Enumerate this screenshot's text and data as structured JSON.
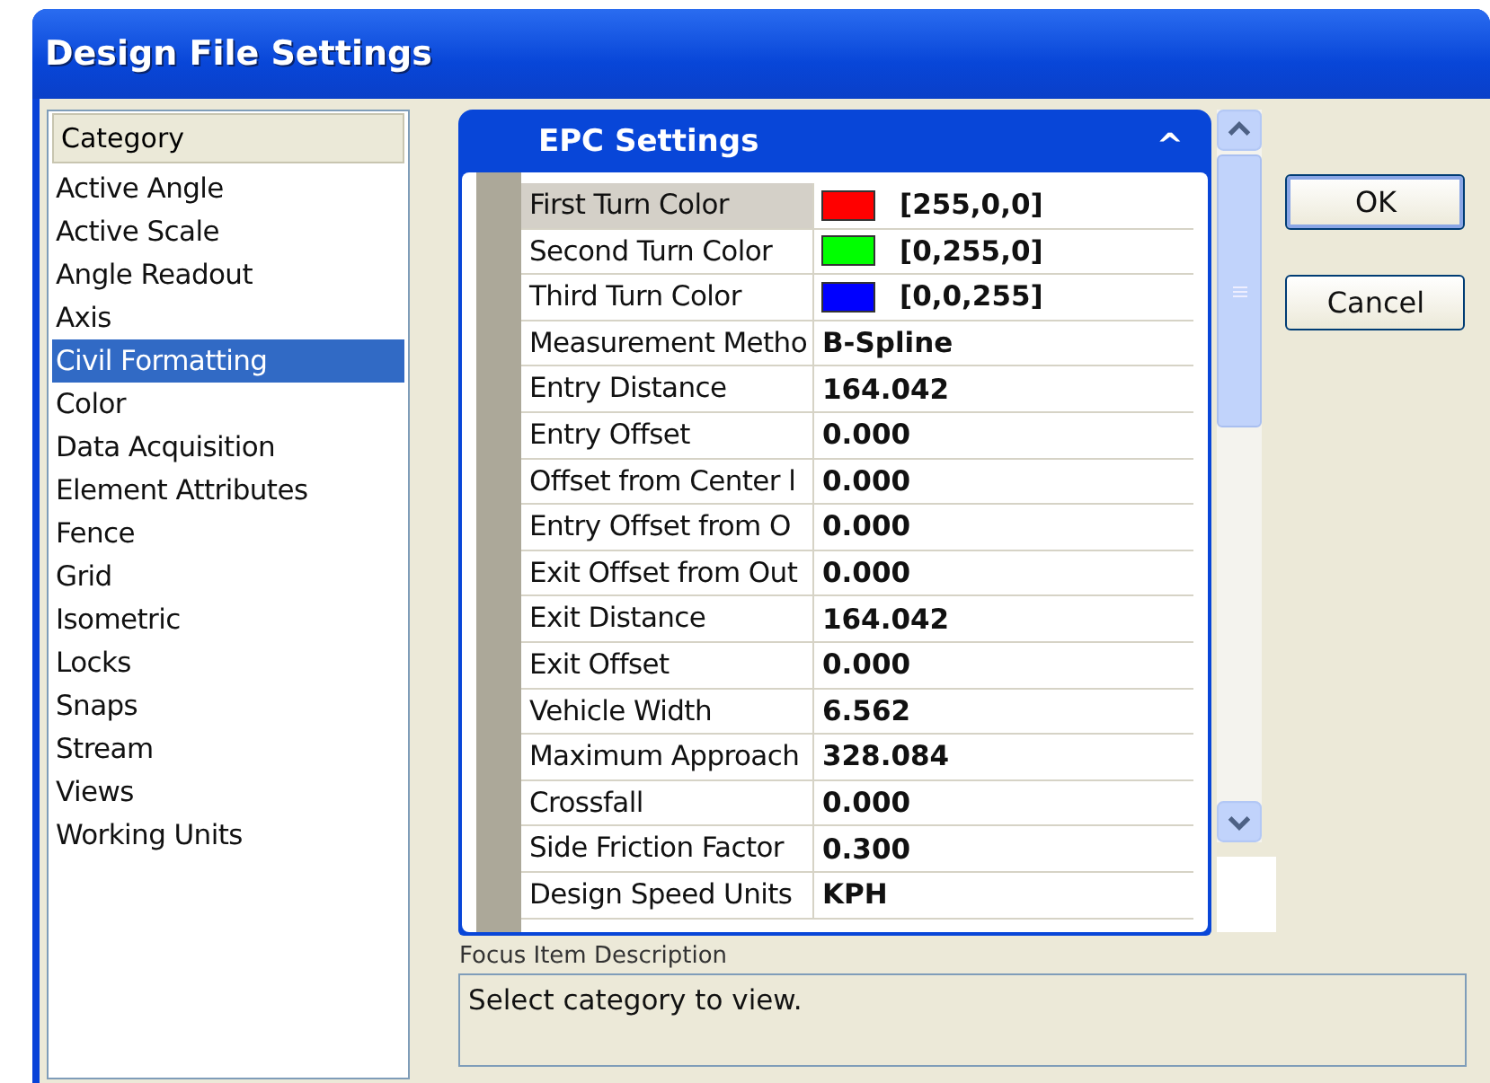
{
  "window": {
    "title": "Design File Settings"
  },
  "category_list": {
    "header": "Category",
    "items": [
      {
        "label": "Active Angle",
        "selected": false
      },
      {
        "label": "Active Scale",
        "selected": false
      },
      {
        "label": "Angle Readout",
        "selected": false
      },
      {
        "label": "Axis",
        "selected": false
      },
      {
        "label": "Civil Formatting",
        "selected": true
      },
      {
        "label": "Color",
        "selected": false
      },
      {
        "label": "Data Acquisition",
        "selected": false
      },
      {
        "label": "Element Attributes",
        "selected": false
      },
      {
        "label": "Fence",
        "selected": false
      },
      {
        "label": "Grid",
        "selected": false
      },
      {
        "label": "Isometric",
        "selected": false
      },
      {
        "label": "Locks",
        "selected": false
      },
      {
        "label": "Snaps",
        "selected": false
      },
      {
        "label": "Stream",
        "selected": false
      },
      {
        "label": "Views",
        "selected": false
      },
      {
        "label": "Working Units",
        "selected": false
      }
    ]
  },
  "panel": {
    "title": "EPC Settings",
    "collapse_glyph": "^",
    "rows": [
      {
        "kind": "color",
        "label": "First Turn Color",
        "value": "[255,0,0]",
        "color": "#ff0000",
        "selected": true
      },
      {
        "kind": "color",
        "label": "Second Turn Color",
        "value": "[0,255,0]",
        "color": "#00ff00",
        "selected": false
      },
      {
        "kind": "color",
        "label": "Third Turn Color",
        "value": "[0,0,255]",
        "color": "#0000ff",
        "selected": false
      },
      {
        "kind": "text",
        "label": "Measurement Metho",
        "value": "B-Spline",
        "selected": false
      },
      {
        "kind": "text",
        "label": "Entry Distance",
        "value": "164.042",
        "selected": false
      },
      {
        "kind": "text",
        "label": "Entry Offset",
        "value": "0.000",
        "selected": false
      },
      {
        "kind": "text",
        "label": "Offset from Center l",
        "value": "0.000",
        "selected": false
      },
      {
        "kind": "text",
        "label": "Entry Offset from O",
        "value": "0.000",
        "selected": false
      },
      {
        "kind": "text",
        "label": "Exit Offset from Out",
        "value": "0.000",
        "selected": false
      },
      {
        "kind": "text",
        "label": "Exit Distance",
        "value": "164.042",
        "selected": false
      },
      {
        "kind": "text",
        "label": "Exit Offset",
        "value": "0.000",
        "selected": false
      },
      {
        "kind": "text",
        "label": "Vehicle Width",
        "value": "6.562",
        "selected": false
      },
      {
        "kind": "text",
        "label": "Maximum Approach",
        "value": "328.084",
        "selected": false
      },
      {
        "kind": "text",
        "label": "Crossfall",
        "value": "0.000",
        "selected": false
      },
      {
        "kind": "text",
        "label": "Side Friction Factor",
        "value": "0.300",
        "selected": false
      },
      {
        "kind": "text",
        "label": "Design Speed Units",
        "value": "KPH",
        "selected": false
      }
    ]
  },
  "buttons": [
    {
      "label": "OK"
    },
    {
      "label": "Cancel"
    }
  ],
  "description": {
    "label": "Focus Item Description",
    "text": "Select category to view."
  }
}
